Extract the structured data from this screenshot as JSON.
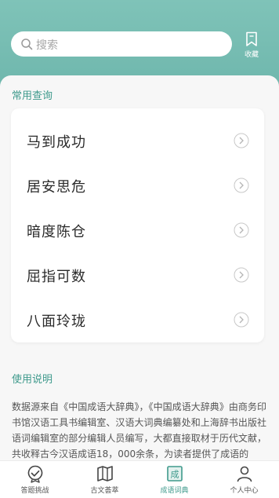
{
  "header": {
    "search_placeholder": "搜索",
    "collect_label": "收藏"
  },
  "common": {
    "title": "常用查询",
    "items": [
      {
        "text": "马到成功"
      },
      {
        "text": "居安思危"
      },
      {
        "text": "暗度陈仓"
      },
      {
        "text": "屈指可数"
      },
      {
        "text": "八面玲珑"
      }
    ]
  },
  "usage": {
    "title": "使用说明",
    "text": "数据源来自《中国成语大辞典》，《中国成语大辞典》由商务印书馆汉语工具书编辑室、汉语大词典编纂处和上海辞书出版社语词编辑室的部分编辑人员编写，大都直接取材于历代文献，共收释古今汉语成语18，000余条，为读者提供了成语的"
  },
  "tabbar": {
    "tabs": [
      {
        "label": "答题挑战"
      },
      {
        "label": "古文荟萃"
      },
      {
        "label": "成语词典"
      },
      {
        "label": "个人中心"
      }
    ],
    "active_index": 2,
    "dict_icon_char": "成"
  },
  "colors": {
    "accent": "#3f9a8c",
    "header": "#77bdb2"
  }
}
